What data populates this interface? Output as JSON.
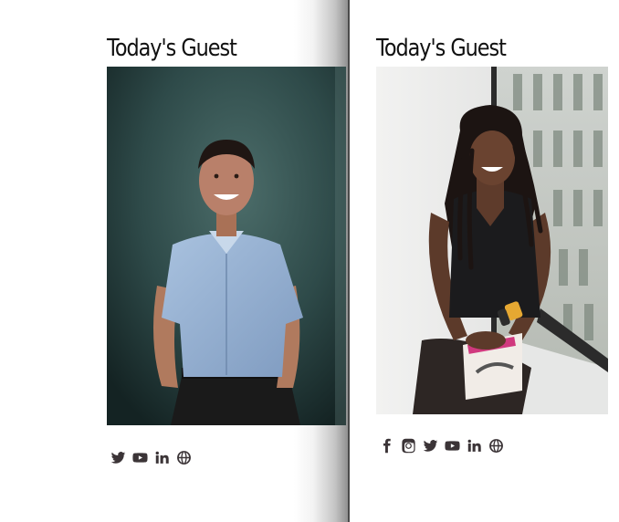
{
  "guests": [
    {
      "title": "Today's Guest",
      "photo_alt": "",
      "socials": [
        {
          "icon": "twitter-icon",
          "label": "Twitter"
        },
        {
          "icon": "youtube-icon",
          "label": "YouTube"
        },
        {
          "icon": "linkedin-icon",
          "label": "LinkedIn"
        },
        {
          "icon": "globe-icon",
          "label": "Website"
        }
      ]
    },
    {
      "title": "Today's Guest",
      "photo_alt": "",
      "socials": [
        {
          "icon": "facebook-icon",
          "label": "Facebook"
        },
        {
          "icon": "instagram-icon",
          "label": "Instagram"
        },
        {
          "icon": "twitter-icon",
          "label": "Twitter"
        },
        {
          "icon": "youtube-icon",
          "label": "YouTube"
        },
        {
          "icon": "linkedin-icon",
          "label": "LinkedIn"
        },
        {
          "icon": "globe-icon",
          "label": "Website"
        }
      ]
    }
  ],
  "colors": {
    "icon": "#3b3437",
    "title": "#111111",
    "divider": "#4b4b4b"
  }
}
